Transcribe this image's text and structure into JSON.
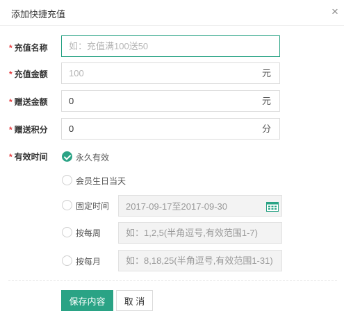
{
  "dialog": {
    "title": "添加快捷充值",
    "close_label": "×"
  },
  "form": {
    "required_mark": "*",
    "name": {
      "label": "充值名称",
      "value": "",
      "placeholder": "如：充值满100送50"
    },
    "amount": {
      "label": "充值金额",
      "value": "",
      "placeholder": "100",
      "unit": "元"
    },
    "gift_amount": {
      "label": "赠送金额",
      "value": "0",
      "unit": "元"
    },
    "gift_points": {
      "label": "赠送积分",
      "value": "0",
      "unit": "分"
    },
    "validity": {
      "label": "有效时间",
      "options": [
        {
          "label": "永久有效",
          "checked": true
        },
        {
          "label": "会员生日当天",
          "checked": false
        },
        {
          "label": "固定时间",
          "checked": false
        },
        {
          "label": "按每周",
          "checked": false
        },
        {
          "label": "按每月",
          "checked": false
        }
      ],
      "fixed_range_value": "2017-09-17至2017-09-30",
      "weekly_placeholder": "如：1,2,5(半角逗号,有效范围1-7)",
      "monthly_placeholder": "如：8,18,25(半角逗号,有效范围1-31)"
    }
  },
  "actions": {
    "save_label": "保存内容",
    "cancel_label": "取 消"
  },
  "colors": {
    "accent": "#2aa385",
    "required": "#e4393c"
  },
  "icons": {
    "close": "close-icon",
    "calendar": "calendar-icon",
    "check": "check-icon"
  }
}
